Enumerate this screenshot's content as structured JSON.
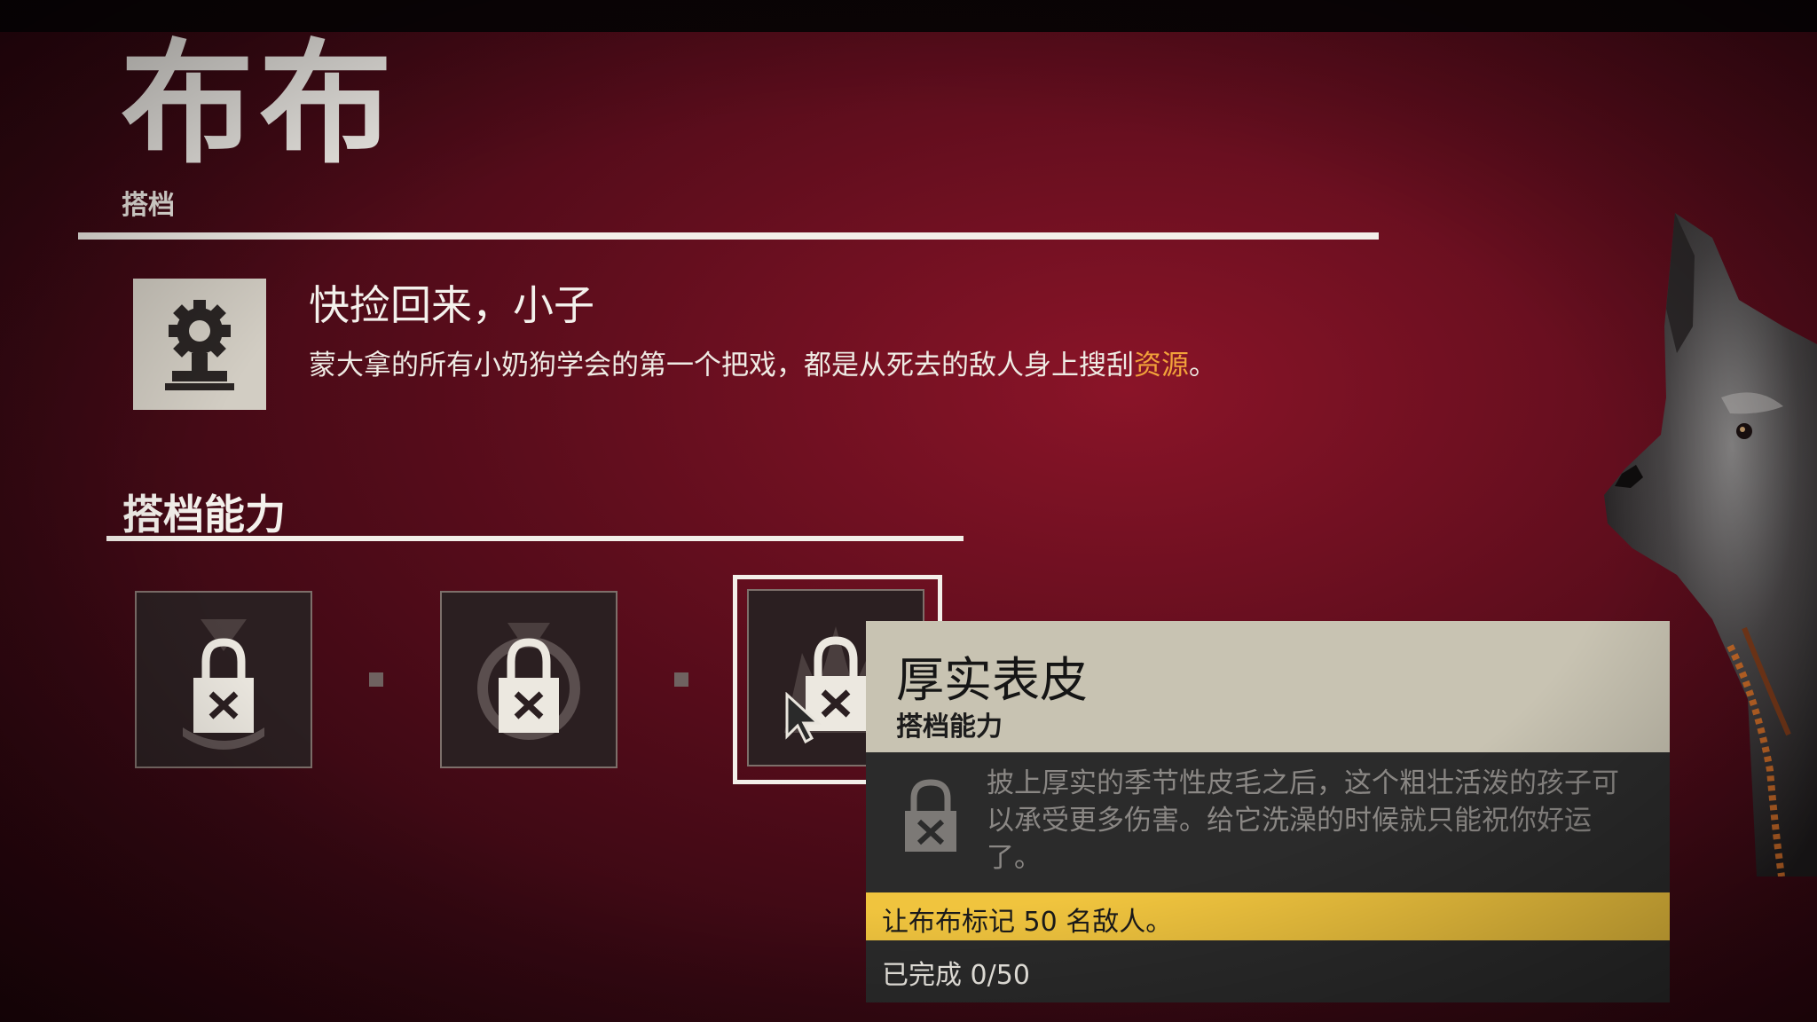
{
  "companion": {
    "name": "布布",
    "category": "搭档"
  },
  "perk": {
    "icon": "gear-person-icon",
    "title": "快捡回来，小子",
    "description_prefix": "蒙大拿的所有小奶狗学会的第一个把戏，都是从死去的敌人身上搜刮",
    "description_highlight": "资源",
    "description_suffix": "。"
  },
  "abilities_section": {
    "title": "搭档能力",
    "slots": [
      {
        "icon": "locked-ability-icon",
        "state": "locked"
      },
      {
        "icon": "locked-ability-icon",
        "state": "locked"
      },
      {
        "icon": "locked-ability-icon",
        "state": "locked",
        "selected": true
      }
    ]
  },
  "tooltip": {
    "name": "厚实表皮",
    "type": "搭档能力",
    "description": "披上厚实的季节性皮毛之后，这个粗壮活泼的孩子可以承受更多伤害。给它洗澡的时候就只能祝你好运了。",
    "requirement": "让布布标记 50 名敌人。",
    "progress": "已完成 0/50",
    "lock_icon": "lock-x-icon"
  },
  "colors": {
    "background": "#5c0d1c",
    "highlight": "#f2a23a",
    "requirement_bar": "#f0c43e",
    "tooltip_header": "#c8c3b2"
  }
}
